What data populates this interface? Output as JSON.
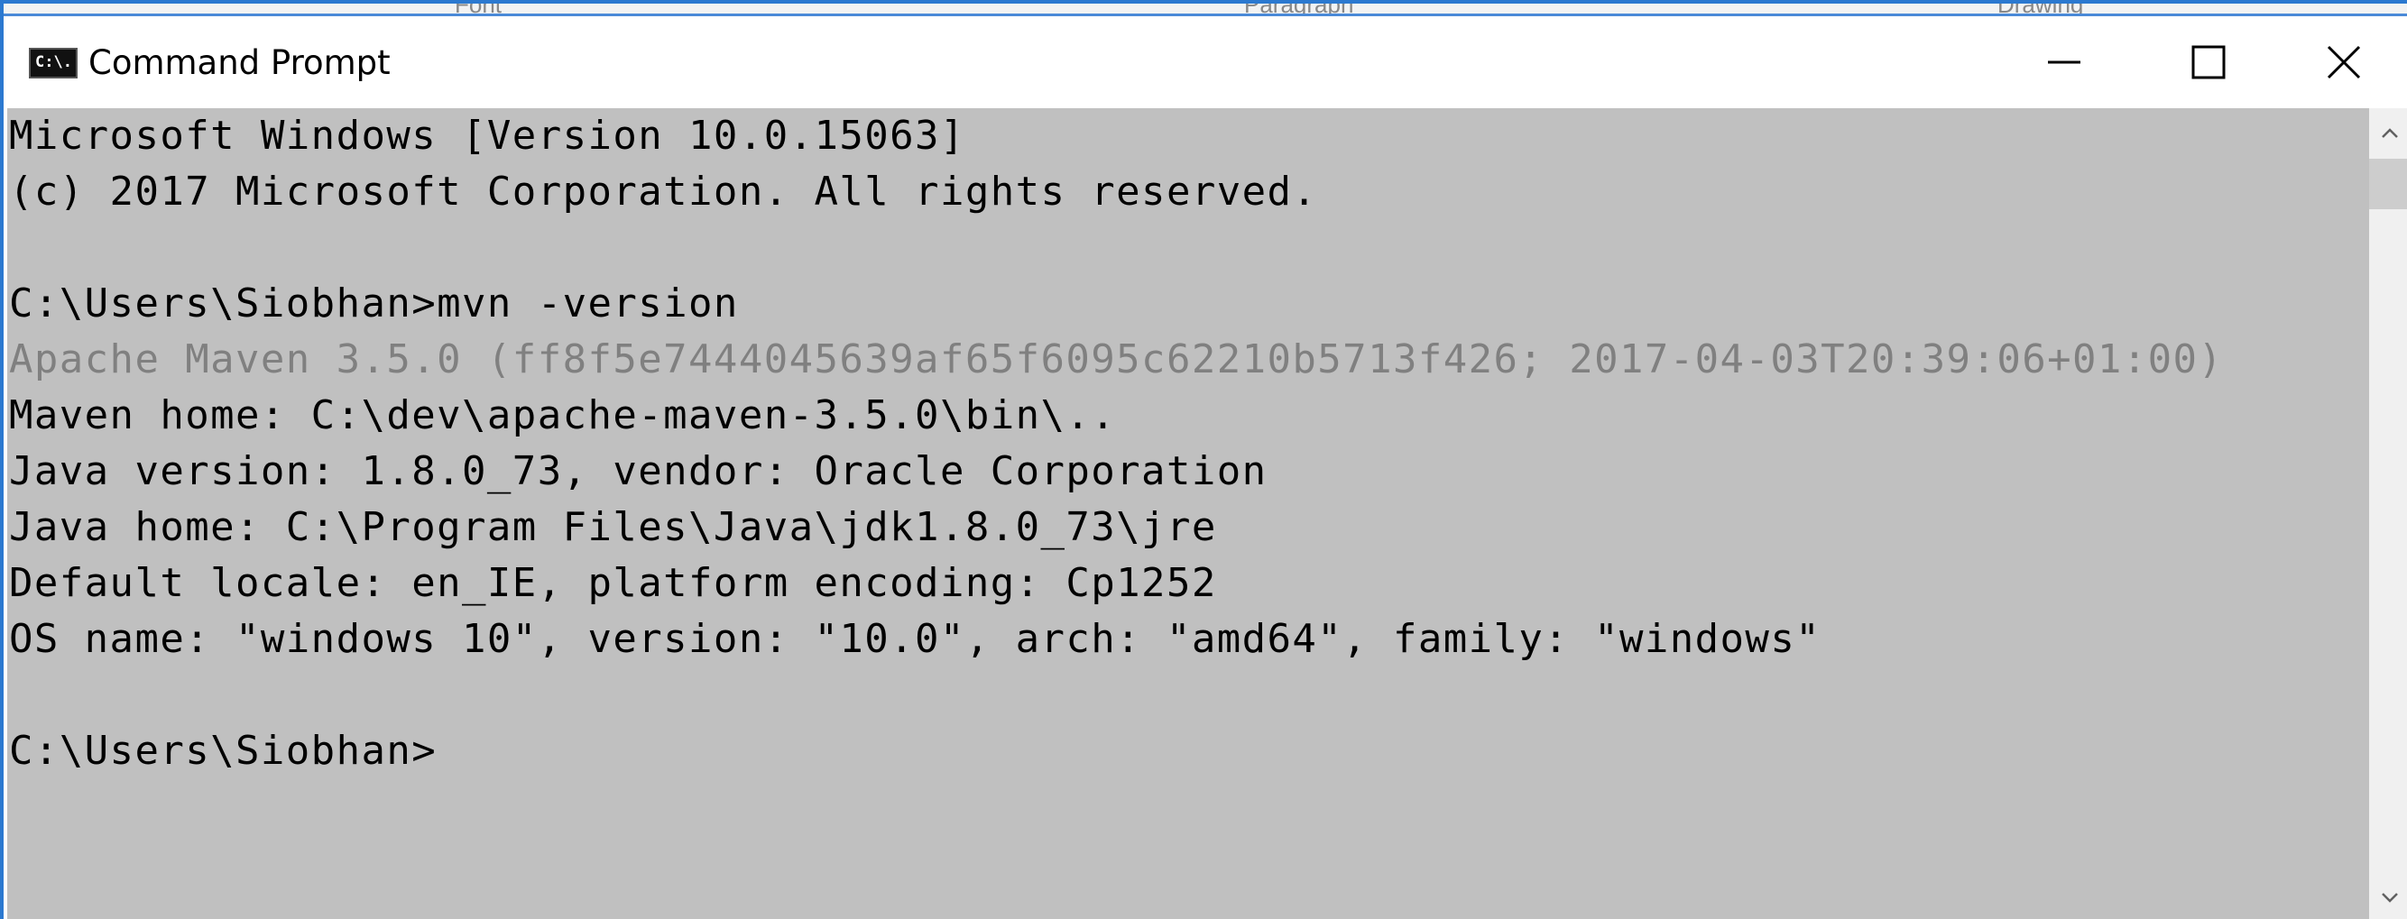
{
  "window": {
    "title": "Command Prompt",
    "icon_name": "console-icon",
    "icon_text": "C:\\.",
    "controls": [
      "minimize-icon",
      "maximize-icon",
      "close-icon"
    ]
  },
  "background_window": {
    "labels": [
      "Font",
      "Paragraph",
      "Drawing"
    ]
  },
  "console": {
    "background_color": "#c0c0c0",
    "text_color": "#000000",
    "dim_text_color": "#808080",
    "lines": [
      {
        "text": "Microsoft Windows [Version 10.0.15063]",
        "dim": false
      },
      {
        "text": "(c) 2017 Microsoft Corporation. All rights reserved.",
        "dim": false
      },
      {
        "text": "",
        "dim": false
      },
      {
        "text": "C:\\Users\\Siobhan>mvn -version",
        "dim": false
      },
      {
        "text": "Apache Maven 3.5.0 (ff8f5e7444045639af65f6095c62210b5713f426; 2017-04-03T20:39:06+01:00)",
        "dim": true
      },
      {
        "text": "Maven home: C:\\dev\\apache-maven-3.5.0\\bin\\..",
        "dim": false
      },
      {
        "text": "Java version: 1.8.0_73, vendor: Oracle Corporation",
        "dim": false
      },
      {
        "text": "Java home: C:\\Program Files\\Java\\jdk1.8.0_73\\jre",
        "dim": false
      },
      {
        "text": "Default locale: en_IE, platform encoding: Cp1252",
        "dim": false
      },
      {
        "text": "OS name: \"windows 10\", version: \"10.0\", arch: \"amd64\", family: \"windows\"",
        "dim": false
      },
      {
        "text": "",
        "dim": false
      },
      {
        "text": "C:\\Users\\Siobhan>",
        "dim": false
      }
    ]
  },
  "scrollbar": {
    "up_icon": "chevron-up-icon",
    "down_icon": "chevron-down-icon"
  }
}
